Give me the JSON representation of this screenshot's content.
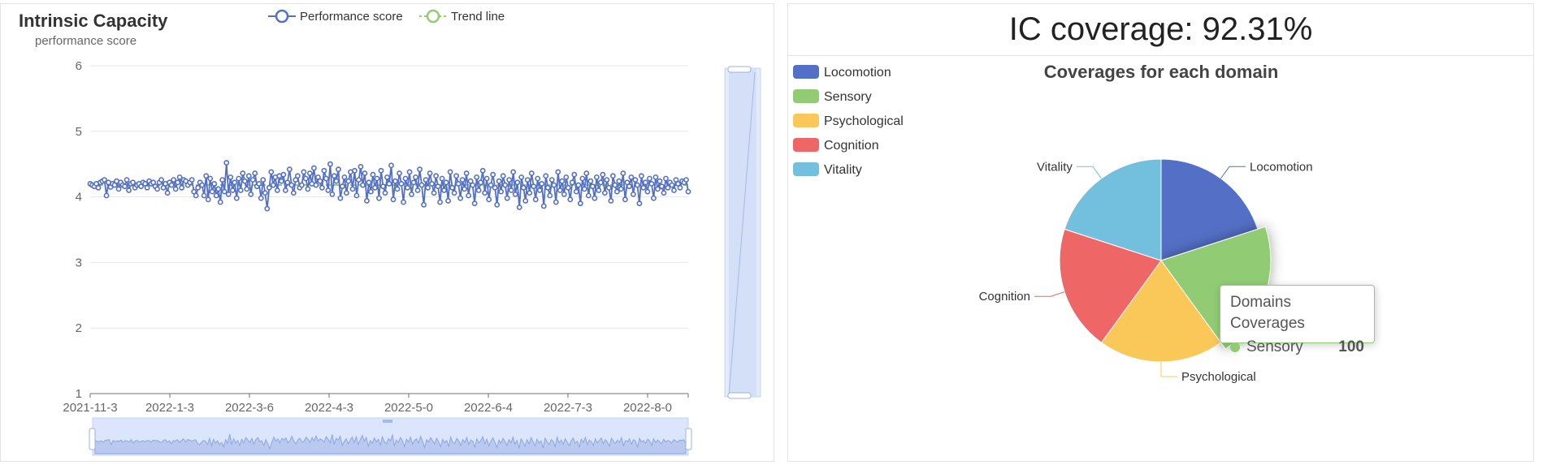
{
  "left_chart": {
    "title": "Intrinsic Capacity",
    "ylabel": "performance score",
    "legend": [
      "Performance score",
      "Trend line"
    ],
    "colors": {
      "performance": "#5470c6",
      "trend": "#91cc75"
    }
  },
  "right": {
    "header": "IC coverage: 92.31%",
    "pie_title": "Coverages for each domain",
    "legend": [
      "Locomotion",
      "Sensory",
      "Psychological",
      "Cognition",
      "Vitality"
    ],
    "tooltip": {
      "title": "Domains Coverages",
      "series": "Sensory",
      "value": "100"
    }
  },
  "chart_data": [
    {
      "type": "line",
      "title": "Intrinsic Capacity",
      "ylabel": "performance score",
      "ylim": [
        1,
        6
      ],
      "yticks": [
        1,
        2,
        3,
        4,
        5,
        6
      ],
      "x_tick_labels": [
        "2021-11-3",
        "2022-1-3",
        "2022-3-6",
        "2022-4-3",
        "2022-5-0",
        "2022-6-4",
        "2022-7-3",
        "2022-8-0"
      ],
      "legend_placement": "top",
      "grid": true,
      "series": [
        {
          "name": "Performance score",
          "color": "#5470c6",
          "values": [
            4.2,
            4.18,
            4.16,
            4.2,
            4.14,
            4.22,
            4.24,
            4.26,
            4.02,
            4.22,
            4.15,
            4.2,
            4.18,
            4.24,
            4.12,
            4.22,
            4.18,
            4.16,
            4.26,
            4.1,
            4.2,
            4.22,
            4.14,
            4.18,
            4.2,
            4.16,
            4.22,
            4.2,
            4.14,
            4.24,
            4.2,
            4.22,
            4.16,
            4.12,
            4.22,
            4.26,
            4.14,
            4.2,
            4.06,
            4.22,
            4.18,
            4.26,
            4.12,
            4.22,
            4.3,
            4.14,
            4.26,
            4.24,
            4.18,
            4.22,
            4.26,
            4.08,
            4.02,
            4.14,
            4.22,
            4.18,
            4.02,
            4.32,
            3.96,
            4.28,
            4.08,
            4.2,
            4.02,
            4.12,
            3.92,
            4.26,
            4.08,
            4.52,
            4.04,
            4.3,
            4.1,
            4.22,
            3.98,
            4.28,
            4.1,
            4.36,
            4.24,
            4.12,
            4.32,
            4.04,
            4.26,
            4.36,
            4.16,
            4.2,
            3.98,
            4.26,
            4.06,
            3.82,
            4.14,
            4.38,
            4.18,
            4.3,
            4.1,
            4.32,
            4.24,
            4.34,
            4.1,
            4.22,
            4.42,
            4.18,
            4.06,
            4.26,
            4.32,
            4.14,
            4.18,
            4.38,
            4.28,
            4.12,
            4.36,
            4.2,
            4.44,
            4.18,
            4.3,
            4.24,
            4.14,
            4.4,
            4.28,
            4.1,
            4.5,
            4.04,
            4.32,
            4.24,
            4.42,
            3.98,
            4.16,
            4.3,
            4.06,
            4.24,
            4.38,
            4.12,
            4.4,
            4.02,
            4.26,
            4.46,
            4.18,
            4.36,
            3.94,
            4.22,
            4.08,
            4.34,
            4.14,
            4.28,
            3.98,
            4.4,
            4.16,
            4.06,
            4.3,
            4.2,
            4.48,
            3.96,
            4.24,
            4.12,
            4.36,
            4.2,
            3.92,
            4.28,
            4.14,
            4.38,
            4.04,
            4.22,
            4.3,
            4.1,
            4.42,
            4.18,
            3.88,
            4.26,
            4.14,
            4.36,
            4.2,
            4.06,
            4.32,
            4.16,
            3.92,
            4.28,
            4.1,
            4.22,
            3.94,
            4.38,
            4.14,
            4.06,
            4.32,
            4.2,
            3.98,
            4.26,
            4.12,
            4.36,
            4.02,
            4.24,
            4.18,
            3.9,
            4.3,
            4.1,
            4.22,
            4.4,
            4.06,
            4.28,
            3.96,
            4.18,
            4.34,
            4.14,
            3.88,
            4.24,
            4.08,
            4.32,
            4.18,
            3.98,
            4.26,
            4.1,
            4.38,
            4.04,
            4.22,
            3.84,
            4.3,
            4.14,
            3.94,
            4.26,
            4.06,
            4.36,
            4.16,
            3.96,
            4.28,
            4.1,
            4.2,
            3.86,
            4.32,
            4.14,
            4.02,
            4.26,
            4.18,
            3.92,
            4.38,
            4.1,
            4.24,
            4.04,
            4.3,
            4.14,
            3.96,
            4.22,
            4.34,
            4.08,
            4.18,
            3.9,
            4.28,
            4.12,
            4.36,
            4.02,
            4.24,
            4.16,
            3.98,
            4.3,
            4.1,
            4.22,
            4.34,
            4.06,
            4.26,
            4.14,
            3.94,
            4.32,
            4.18,
            4.08,
            4.24,
            4.12,
            4.36,
            3.96,
            4.22,
            4.16,
            4.3,
            4.04,
            4.26,
            4.18,
            3.9,
            4.32,
            4.14,
            4.22,
            4.08,
            4.28,
            4.2,
            3.98,
            4.3,
            4.12,
            4.24,
            4.16,
            4.06,
            4.28,
            4.14,
            4.22,
            4.18,
            4.1,
            4.26,
            4.2,
            4.14,
            4.24,
            4.22,
            4.26,
            4.08
          ]
        },
        {
          "name": "Trend line",
          "color": "#91cc75",
          "values": [
            4.18,
            4.18,
            4.18,
            4.18,
            4.18,
            4.18,
            4.18,
            4.18,
            4.18,
            4.18
          ]
        }
      ]
    },
    {
      "type": "pie",
      "title": "Coverages for each domain",
      "legend_placement": "top-left",
      "categories": [
        "Locomotion",
        "Sensory",
        "Psychological",
        "Cognition",
        "Vitality"
      ],
      "values": [
        100,
        100,
        100,
        100,
        100
      ],
      "colors": [
        "#5470c6",
        "#91cc75",
        "#fac858",
        "#ee6666",
        "#73c0de"
      ],
      "highlighted": "Sensory"
    }
  ]
}
